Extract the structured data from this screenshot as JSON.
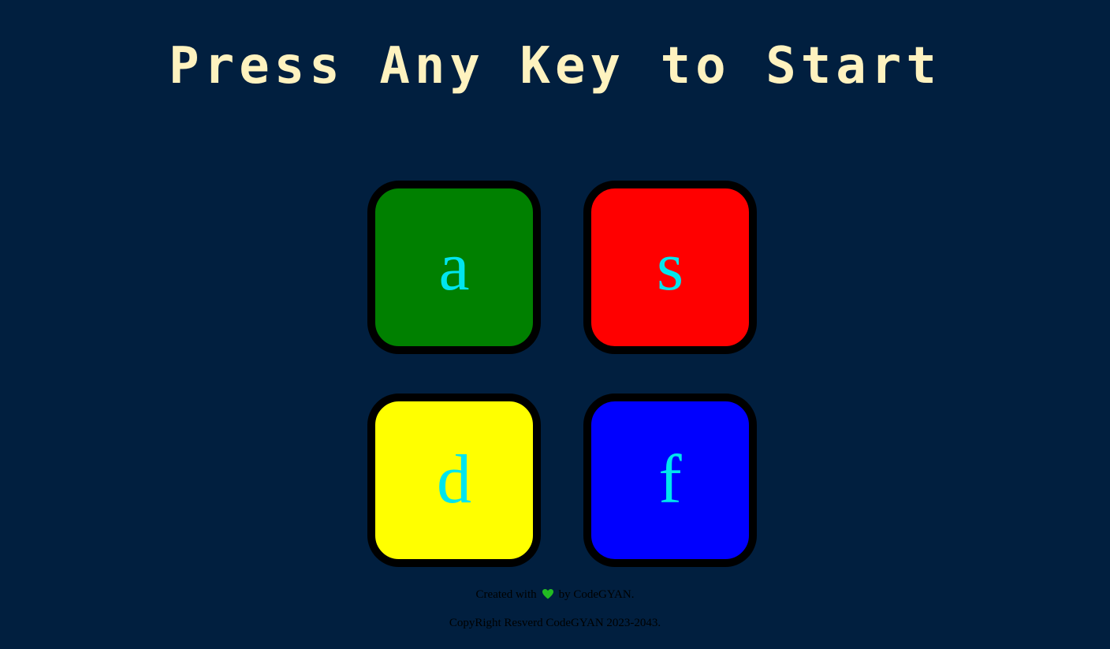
{
  "title": "Press Any Key to Start",
  "buttons": [
    {
      "key": "a",
      "color_name": "green",
      "color": "#008000"
    },
    {
      "key": "s",
      "color_name": "red",
      "color": "#ff0000"
    },
    {
      "key": "d",
      "color_name": "yellow",
      "color": "#ffff00"
    },
    {
      "key": "f",
      "color_name": "blue",
      "color": "#0000ff"
    }
  ],
  "footer": {
    "created_prefix": "Created with",
    "heart_icon": "green-heart-icon",
    "created_suffix": "by CodeGYAN.",
    "copyright": "CopyRight Resverd CodeGYAN 2023-2043."
  },
  "colors": {
    "background": "#011f3f",
    "title": "#fef2bf",
    "key_letter": "#00e5ee",
    "heart": "#22bb22"
  }
}
